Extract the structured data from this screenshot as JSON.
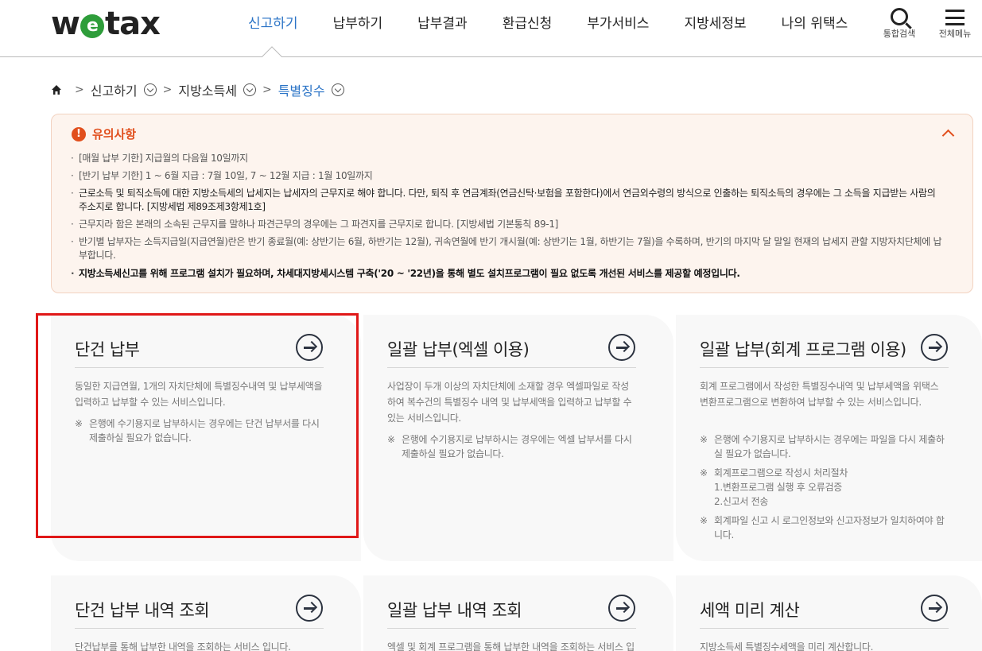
{
  "header": {
    "logo": {
      "w": "w",
      "e": "e",
      "tax": "tax"
    },
    "nav": [
      {
        "label": "신고하기",
        "active": true
      },
      {
        "label": "납부하기",
        "active": false
      },
      {
        "label": "납부결과",
        "active": false
      },
      {
        "label": "환급신청",
        "active": false
      },
      {
        "label": "부가서비스",
        "active": false
      },
      {
        "label": "지방세정보",
        "active": false
      },
      {
        "label": "나의 위택스",
        "active": false
      }
    ],
    "tools": {
      "search_label": "통합검색",
      "menu_label": "전체메뉴"
    }
  },
  "breadcrumb": {
    "items": [
      "신고하기",
      "지방소득세",
      "특별징수"
    ]
  },
  "notice": {
    "title": "유의사항",
    "items": [
      "[매월 납부 기한] 지급월의 다음월 10일까지",
      "[반기 납부 기한] 1 ~ 6월 지급 : 7월 10일, 7 ~ 12월 지급 : 1월 10일까지",
      "근로소득 및 퇴직소득에 대한 지방소득세의 납세지는 납세자의 근무지로 해야 합니다. 다만, 퇴직 후 연금계좌(연금신탁·보험을 포함한다)에서 연금외수령의 방식으로 인출하는 퇴직소득의 경우에는 그 소득을 지급받는 사람의 주소지로 합니다. [지방세법 제89조제3항제1호]",
      "근무지라 함은 본래의 소속된 근무지를 말하나 파견근무의 경우에는 그 파견지를 근무지로 합니다. [지방세법 기본통칙 89-1]",
      "반기별 납부자는 소득지급일(지급연월)란은 반기 종료월(예: 상반기는 6월, 하반기는 12월), 귀속연월에 반기 개시월(예: 상반기는 1월, 하반기는 7월)을 수록하며, 반기의 마지막 달 말일 현재의 납세지 관할 지방자치단체에 납부합니다.",
      "지방소득세신고를 위해 프로그램 설치가 필요하며, 차세대지방세시스템 구축('20 ~ '22년)을 통해 별도 설치프로그램이 필요 없도록 개선된 서비스를 제공할 예정입니다."
    ]
  },
  "cards": [
    {
      "title": "단건 납부",
      "desc": "동일한 지급연월, 1개의 자치단체에 특별징수내역 및 납부세액을 입력하고 납부할 수 있는 서비스입니다.",
      "notes": [
        "은행에 수기용지로 납부하시는 경우에는 단건 납부서를 다시 제출하실 필요가 없습니다."
      ]
    },
    {
      "title": "일괄 납부(엑셀 이용)",
      "desc": "사업장이 두개 이상의 자치단체에 소재할 경우 엑셀파일로 작성하여 복수건의 특별징수 내역 및 납부세액을 입력하고 납부할 수 있는 서비스입니다.",
      "notes": [
        "은행에 수기용지로 납부하시는 경우에는 엑셀 납부서를 다시 제출하실 필요가 없습니다."
      ]
    },
    {
      "title": "일괄 납부(회계 프로그램 이용)",
      "desc": "회계 프로그램에서 작성한 특별징수내역 및 납부세액을 위택스 변환프로그램으로 변환하여 납부할 수 있는 서비스입니다.",
      "notes": [
        "은행에 수기용지로 납부하시는 경우에는 파일을 다시 제출하실 필요가 없습니다.",
        "회계프로그램으로 작성시 처리절차\n1.변환프로그램 실행 후 오류검증\n2.신고서 전송",
        "회계파일 신고 시 로그인정보와 신고자정보가 일치하여야 합니다."
      ]
    },
    {
      "title": "단건 납부 내역 조회",
      "desc": "단건납부를 통해 납부한 내역을 조회하는 서비스 입니다."
    },
    {
      "title": "일괄 납부 내역 조회",
      "desc": "엑셀 및 회계 프로그램을 통해 납부한 내역을 조회하는 서비스 입니다."
    },
    {
      "title": "세액 미리 계산",
      "desc": "지방소득세 특별징수세액을 미리 계산합니다."
    }
  ]
}
